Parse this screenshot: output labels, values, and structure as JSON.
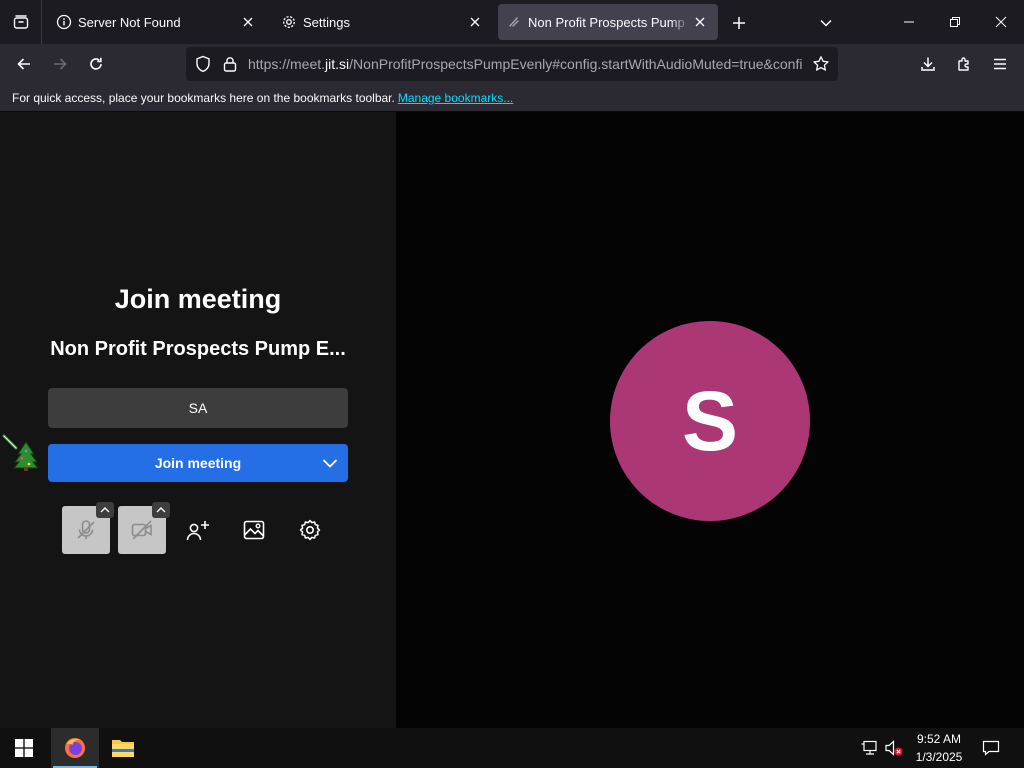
{
  "browser": {
    "tabs": [
      {
        "title": "Server Not Found",
        "icon": "info-icon",
        "active": false
      },
      {
        "title": "Settings",
        "icon": "gear-icon",
        "active": false
      },
      {
        "title": "Non Profit Prospects Pump Evenly",
        "icon": "jitsi-icon",
        "active": true
      }
    ],
    "url": {
      "prefix": "https://meet.",
      "host": "jit.si",
      "path": "/NonProfitProspectsPumpEvenly#config.startWithAudioMuted=true&config.startWithVideoMuted=true"
    },
    "bookmarks_bar": {
      "message": "For quick access, place your bookmarks here on the bookmarks toolbar.",
      "link": "Manage bookmarks..."
    }
  },
  "prejoin": {
    "title": "Join meeting",
    "room_name": "Non Profit Prospects Pump E...",
    "name_value": "SA",
    "join_button": "Join meeting",
    "toolbar": [
      "microphone-muted-icon",
      "camera-off-icon",
      "invite-icon",
      "virtual-background-icon",
      "gear-icon"
    ]
  },
  "avatar": {
    "initial": "S",
    "color": "#ab3774"
  },
  "colors": {
    "accent": "#246fe5",
    "panel": "#141414",
    "link": "#00ddff"
  },
  "taskbar": {
    "time": "9:52 AM",
    "date": "1/3/2025",
    "apps": [
      "firefox-icon",
      "file-explorer-icon"
    ]
  }
}
